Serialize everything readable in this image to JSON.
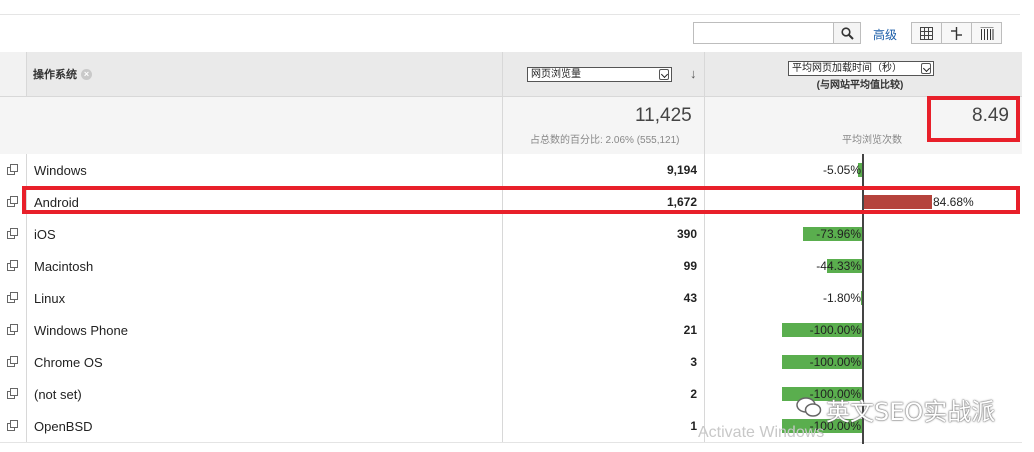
{
  "toolbar": {
    "search_placeholder": "",
    "advanced_label": "高级"
  },
  "header": {
    "dimension_label": "操作系统",
    "metric_select": "网页浏览量",
    "compare_select": "平均网页加载时间（秒）",
    "compare_sub": "(与网站平均值比较)"
  },
  "summary": {
    "pageviews": "11,425",
    "pageviews_note": "占总数的百分比: 2.06% (555,121)",
    "avg_value": "8.49",
    "avg_note": "平均浏览次数"
  },
  "rows": [
    {
      "name": "Windows",
      "value": "9,194",
      "pct": "-5.05%",
      "delta": -5.05
    },
    {
      "name": "Android",
      "value": "1,672",
      "pct": "84.68%",
      "delta": 84.68
    },
    {
      "name": "iOS",
      "value": "390",
      "pct": "-73.96%",
      "delta": -73.96
    },
    {
      "name": "Macintosh",
      "value": "99",
      "pct": "-44.33%",
      "delta": -44.33
    },
    {
      "name": "Linux",
      "value": "43",
      "pct": "-1.80%",
      "delta": -1.8
    },
    {
      "name": "Windows Phone",
      "value": "21",
      "pct": "-100.00%",
      "delta": -100
    },
    {
      "name": "Chrome OS",
      "value": "3",
      "pct": "-100.00%",
      "delta": -100
    },
    {
      "name": "(not set)",
      "value": "2",
      "pct": "-100.00%",
      "delta": -100
    },
    {
      "name": "OpenBSD",
      "value": "1",
      "pct": "-100.00%",
      "delta": -100
    }
  ],
  "colors": {
    "negative_bar": "#5aae4e",
    "positive_bar": "#b5433c",
    "highlight": "#e8202a",
    "link": "#1a5da8"
  },
  "watermark": {
    "activate": "Activate Windows",
    "brand": "英文SEO实战派"
  }
}
